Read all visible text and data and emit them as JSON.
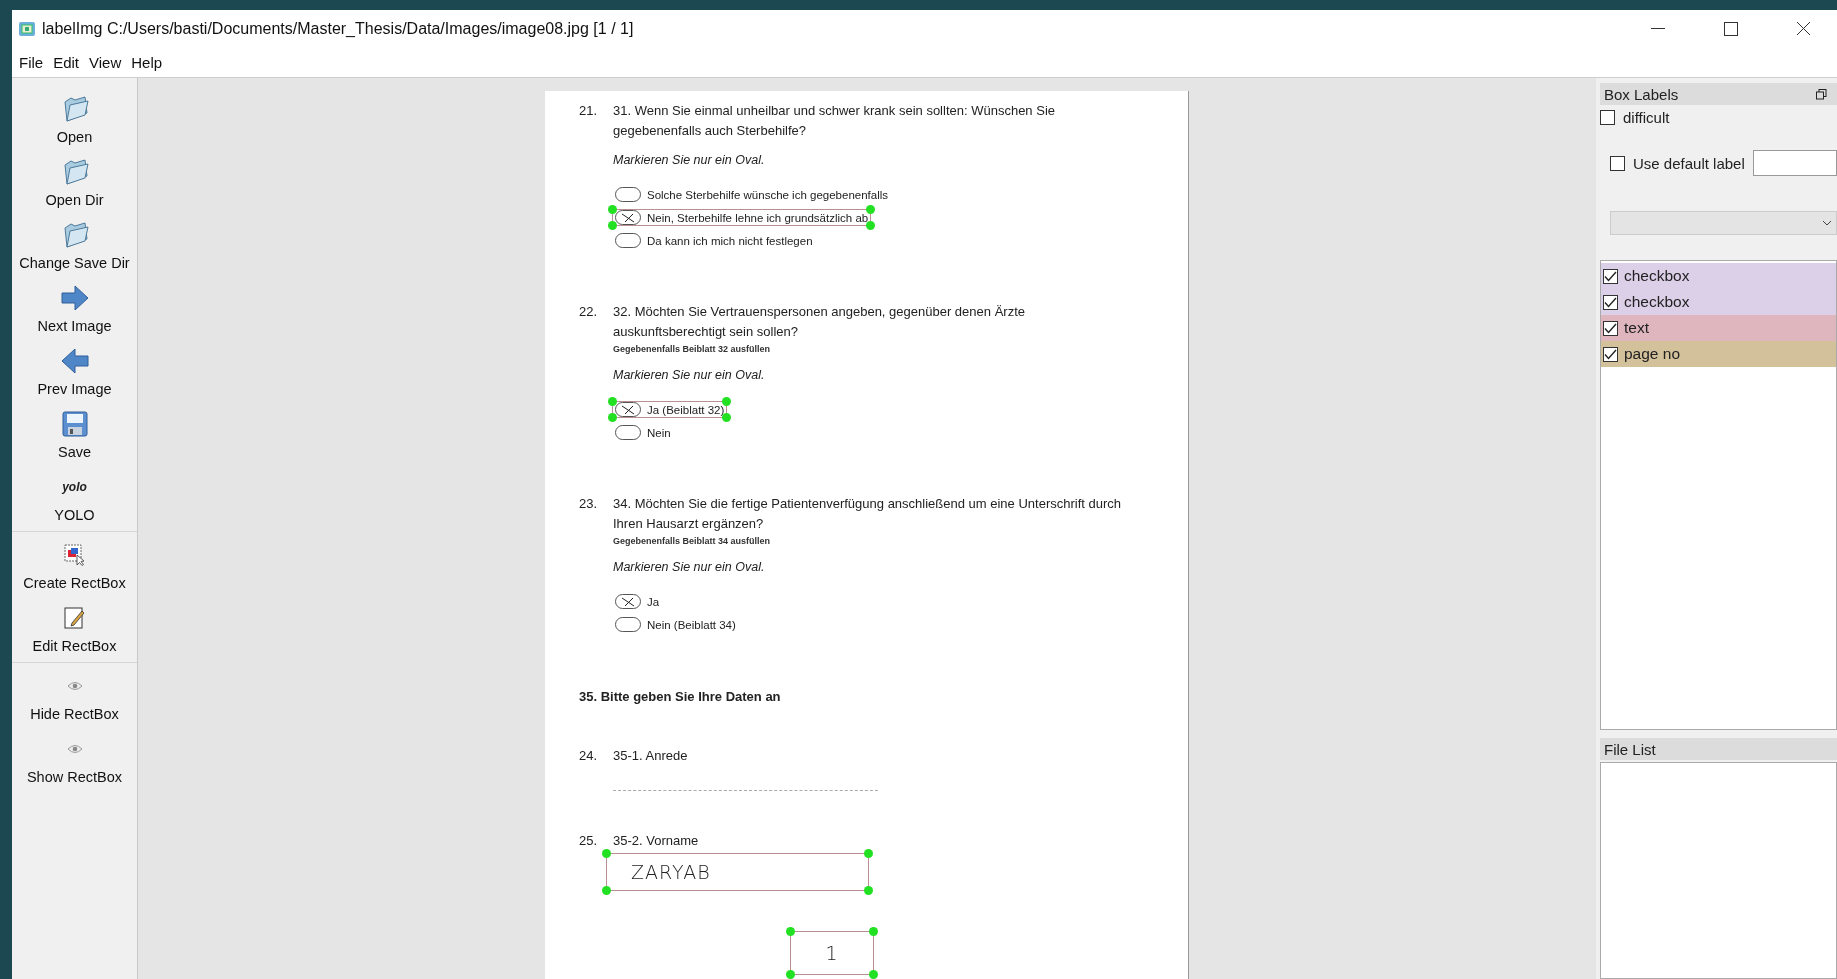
{
  "window": {
    "title": "labelImg C:/Users/basti/Documents/Master_Thesis/Data/Images/image08.jpg [1 / 1]"
  },
  "menu": [
    {
      "label": "File"
    },
    {
      "label": "Edit"
    },
    {
      "label": "View"
    },
    {
      "label": "Help"
    }
  ],
  "tool_groups": [
    {
      "tools": [
        {
          "kind": "folder",
          "label": "Open"
        },
        {
          "kind": "folder",
          "label": "Open Dir"
        },
        {
          "kind": "folder",
          "label": "Change Save Dir"
        },
        {
          "kind": "next",
          "label": "Next Image"
        },
        {
          "kind": "prev",
          "label": "Prev Image"
        },
        {
          "kind": "save",
          "label": "Save"
        },
        {
          "kind": "text",
          "glyph": "yolo",
          "label": "YOLO"
        }
      ]
    },
    {
      "tools": [
        {
          "kind": "create",
          "label": "Create RectBox"
        },
        {
          "kind": "edit",
          "label": "Edit RectBox"
        }
      ]
    },
    {
      "tools": [
        {
          "kind": "eye",
          "label": "Hide RectBox"
        },
        {
          "kind": "eye",
          "label": "Show RectBox"
        }
      ]
    }
  ],
  "document": {
    "items": [
      {
        "kind": "choice",
        "number": "21.",
        "lines": [
          "31. Wenn Sie einmal unheilbar und schwer krank sein sollten: Wünschen Sie",
          "gegebenenfalls auch Sterbehilfe?"
        ],
        "instruction": "Markieren Sie nur ein Oval.",
        "options": [
          {
            "label": "Solche Sterbehilfe wünsche ich gegebenenfalls",
            "checked": false,
            "annotated": false
          },
          {
            "label": "Nein, Sterbehilfe lehne ich grundsätzlich ab",
            "checked": true,
            "annotated": true
          },
          {
            "label": "Da kann ich mich nicht festlegen",
            "checked": false,
            "annotated": false
          }
        ]
      },
      {
        "kind": "choice",
        "number": "22.",
        "lines": [
          "32. Möchten Sie Vertrauenspersonen angeben, gegenüber denen Ärzte",
          "auskunftsberechtigt sein sollen?"
        ],
        "note": "Gegebenenfalls Beiblatt 32 ausfüllen",
        "instruction": "Markieren Sie nur ein Oval.",
        "options": [
          {
            "label": "Ja (Beiblatt 32)",
            "checked": true,
            "annotated": true
          },
          {
            "label": "Nein",
            "checked": false,
            "annotated": false
          }
        ]
      },
      {
        "kind": "choice",
        "number": "23.",
        "lines": [
          "34. Möchten Sie die fertige Patientenverfügung anschließend um eine Unterschrift durch",
          "Ihren Hausarzt ergänzen?"
        ],
        "note": "Gegebenenfalls Beiblatt 34 ausfüllen",
        "instruction": "Markieren Sie nur ein Oval.",
        "options": [
          {
            "label": "Ja",
            "checked": true,
            "annotated": false
          },
          {
            "label": "Nein (Beiblatt 34)",
            "checked": false,
            "annotated": false
          }
        ]
      },
      {
        "kind": "heading",
        "text": "35. Bitte geben Sie Ihre Daten an"
      },
      {
        "kind": "text",
        "number": "24.",
        "title": "35-1. Anrede"
      },
      {
        "kind": "text",
        "number": "25.",
        "title": "35-2. Vorname",
        "value": "ZARYAB",
        "annotated": true
      },
      {
        "kind": "page_number",
        "value": "1",
        "annotated": true
      }
    ]
  },
  "box_labels": {
    "title": "Box Labels",
    "difficult": {
      "label": "difficult",
      "checked": false
    },
    "use_default": {
      "label": "Use default label",
      "checked": false
    },
    "labels": [
      {
        "label": "checkbox",
        "checked": true,
        "color": "#dccfe8"
      },
      {
        "label": "checkbox",
        "checked": true,
        "color": "#dccfe8"
      },
      {
        "label": "text",
        "checked": true,
        "color": "#dfb6bd"
      },
      {
        "label": "page no",
        "checked": true,
        "color": "#d2c19a"
      }
    ]
  },
  "file_list": {
    "title": "File List"
  }
}
